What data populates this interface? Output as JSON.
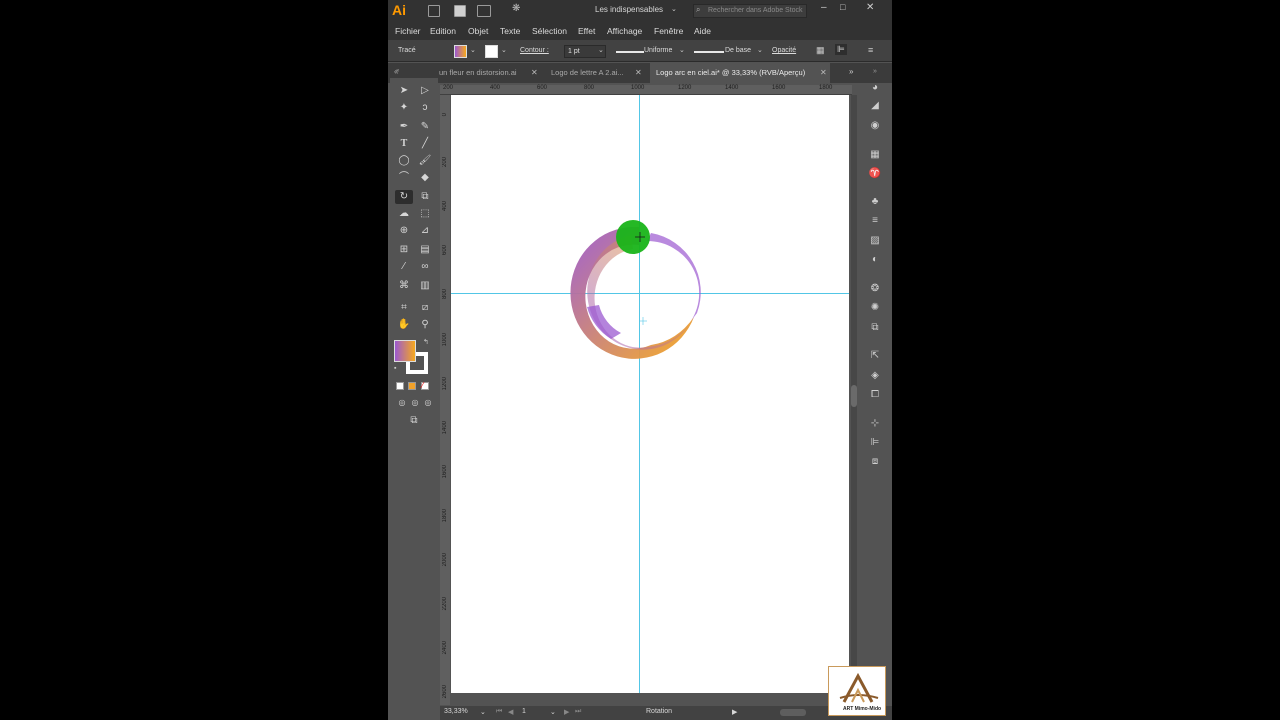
{
  "app": {
    "logo": "Ai",
    "workspace": "Les indispensables",
    "search_placeholder": "Rechercher dans Adobe Stock"
  },
  "menu": [
    "Fichier",
    "Edition",
    "Objet",
    "Texte",
    "Sélection",
    "Effet",
    "Affichage",
    "Fenêtre",
    "Aide"
  ],
  "control_bar": {
    "selection_label": "Tracé",
    "fill_color": "#9b59d0",
    "stroke_label": "Contour :",
    "stroke_weight": "1 pt",
    "profile": "Uniforme",
    "brush": "De base",
    "opacity_label": "Opacité"
  },
  "tabs": [
    {
      "label": "un fleur en distorsion.ai",
      "active": false
    },
    {
      "label": "Logo de lettre A 2.ai...",
      "active": false
    },
    {
      "label": "Logo arc en ciel.ai* @ 33,33% (RVB/Aperçu)",
      "active": true
    }
  ],
  "ruler_top_labels": [
    "200",
    "400",
    "600",
    "800",
    "1000",
    "1200",
    "1400",
    "1600",
    "1800"
  ],
  "ruler_left_labels": [
    "0",
    "200",
    "400",
    "600",
    "800",
    "1000",
    "1200",
    "1400",
    "1600",
    "1800",
    "2000",
    "2200",
    "2400",
    "2600"
  ],
  "status": {
    "zoom": "33,33%",
    "artboard": "1",
    "tool": "Rotation"
  },
  "colors": {
    "gradient_start": "#9b59d0",
    "gradient_end": "#f7a91d",
    "guide": "#52c6e6",
    "pivot": "#19b419"
  },
  "watermark": {
    "text": "ART Mimo-Mido"
  },
  "icons": {
    "tools": [
      "selection-icon",
      "direct-selection-icon",
      "magic-wand-icon",
      "lasso-icon",
      "pen-icon",
      "curvature-icon",
      "type-icon",
      "line-icon",
      "ellipse-icon",
      "paintbrush-icon",
      "shaper-icon",
      "eraser-icon",
      "rotate-icon",
      "scale-icon",
      "warp-icon",
      "free-transform-icon",
      "shape-builder-icon",
      "perspective-icon",
      "mesh-icon",
      "gradient-icon",
      "eyedropper-icon",
      "blend-icon",
      "symbol-sprayer-icon",
      "graph-icon",
      "artboard-icon",
      "slice-icon",
      "hand-icon",
      "zoom-icon"
    ]
  }
}
